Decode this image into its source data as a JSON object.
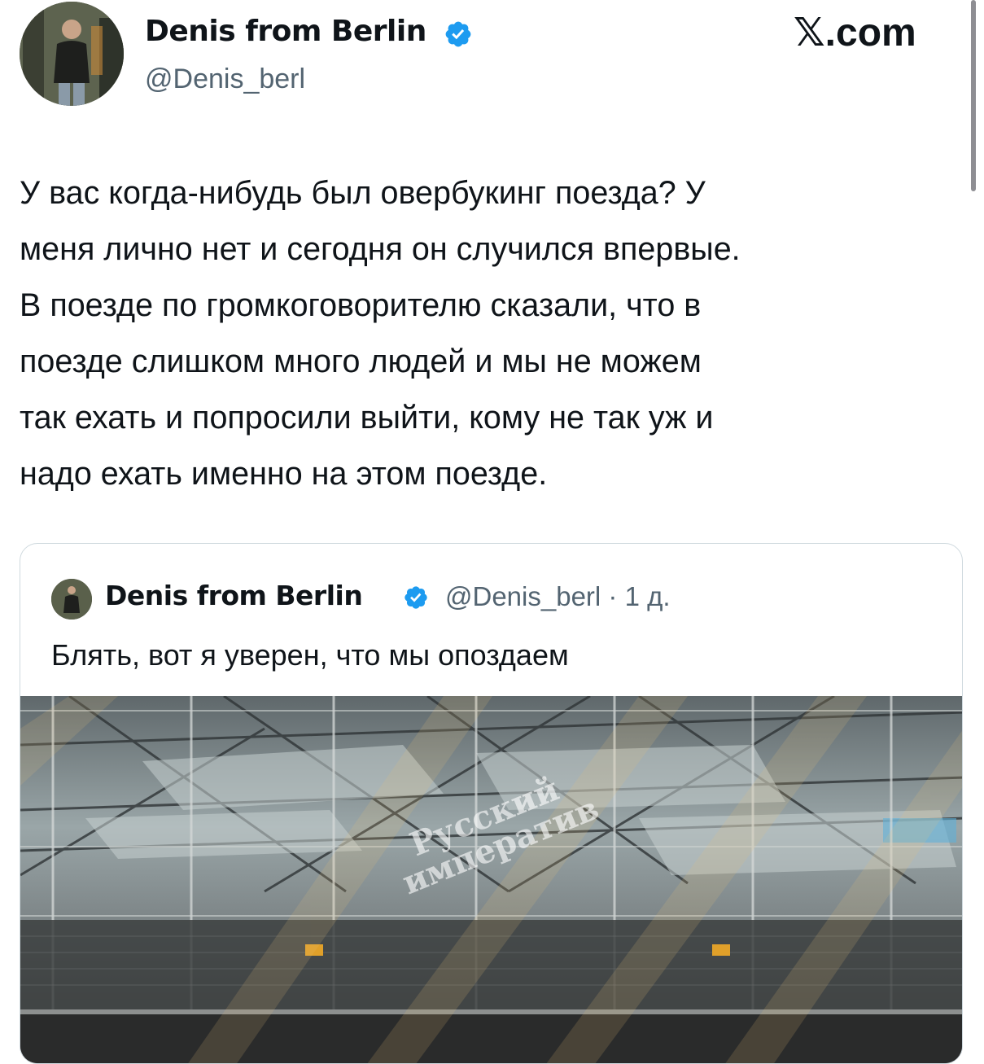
{
  "header": {
    "author_name": "Denis from Berlin",
    "handle": "@Denis_berl",
    "brand": "𝕏.com",
    "verified_color": "#1d9bf0"
  },
  "tweet": {
    "lines": [
      "У вас когда-нибудь был овербукинг поезда? У",
      "меня лично нет и сегодня он случился впервые.",
      "В поезде по громкоговорителю сказали, что в",
      "поезде слишком много людей и мы не можем",
      "так ехать и попросили выйти, кому не так уж и",
      "надо ехать именно на этом поезде."
    ]
  },
  "quote": {
    "author_name": "Denis from Berlin",
    "meta": "@Denis_berl · 1 д.",
    "text": "Блять, вот я уверен, что мы опоздаем",
    "photo": {
      "watermark_line1": "Русский",
      "watermark_line2": "императив"
    }
  }
}
